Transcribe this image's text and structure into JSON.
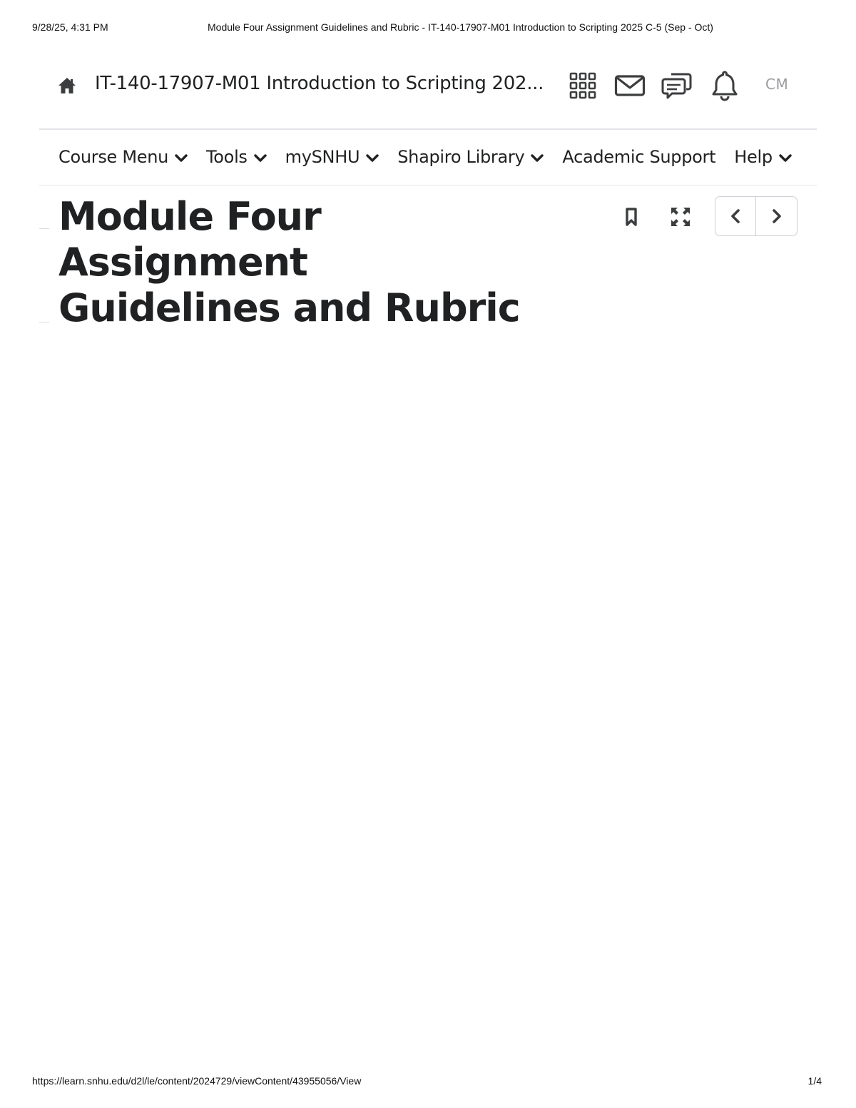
{
  "print_header": {
    "datetime": "9/28/25, 4:31 PM",
    "document_title": "Module Four Assignment Guidelines and Rubric - IT-140-17907-M01 Introduction to Scripting 2025 C-5 (Sep - Oct)"
  },
  "topbar": {
    "course_title": "IT-140-17907-M01 Introduction to Scripting 202...",
    "icons": [
      "home-icon",
      "app-grid-icon",
      "mail-icon",
      "chat-icon",
      "bell-icon"
    ],
    "avatar_initials": "CM"
  },
  "navbar": {
    "items": [
      {
        "label": "Course Menu",
        "has_dropdown": true
      },
      {
        "label": "Tools",
        "has_dropdown": true
      },
      {
        "label": "mySNHU",
        "has_dropdown": true
      },
      {
        "label": "Shapiro Library",
        "has_dropdown": true
      },
      {
        "label": "Academic Support",
        "has_dropdown": false
      },
      {
        "label": "Help",
        "has_dropdown": true
      }
    ]
  },
  "content": {
    "title_line1": "Module Four Assignment",
    "title_line2": "Guidelines and Rubric",
    "controls": [
      "bookmark-icon",
      "fullscreen-icon",
      "chevron-left-icon",
      "chevron-right-icon"
    ]
  },
  "print_footer": {
    "url": "https://learn.snhu.edu/d2l/le/content/2024729/viewContent/43955056/View",
    "page": "1/4"
  },
  "colors": {
    "text": "#202122",
    "icon": "#3c3d3f",
    "avatar_text": "#9a9c9f",
    "divider": "#e3e5e8",
    "border": "#cdd0d4"
  }
}
